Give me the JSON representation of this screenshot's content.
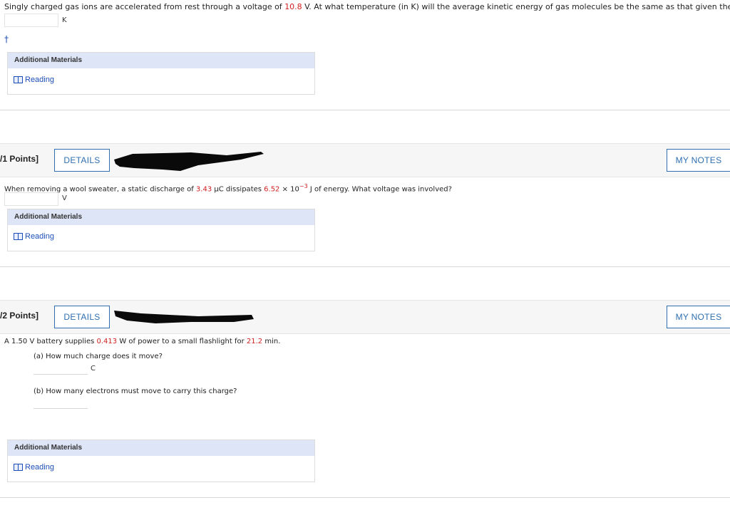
{
  "q0": {
    "text_before": "Singly charged gas ions are accelerated from rest through a voltage of ",
    "voltage": "10.8",
    "text_after": " V. At what temperature (in K) will the average kinetic energy of gas molecules be the same as that given these ions?",
    "unit": "K",
    "dagger": "†"
  },
  "additional_materials": {
    "title": "Additional Materials",
    "reading": "Reading"
  },
  "q1": {
    "points": "/1 Points]",
    "details": "DETAILS",
    "my_notes": "MY NOTES",
    "text_1": "When removing a wool sweater, a static discharge of ",
    "charge": "3.43",
    "text_2": " μC dissipates ",
    "energy": "6.52",
    "times": " × 10",
    "exp": "−3",
    "text_3": " J of energy. What voltage was involved?",
    "unit": "V"
  },
  "q2": {
    "points": "/2 Points]",
    "details": "DETAILS",
    "my_notes": "MY NOTES",
    "text_1": "A 1.50 V battery supplies ",
    "power": "0.413",
    "text_2": " W of power to a small flashlight for ",
    "time": "21.2",
    "text_3": " min.",
    "part_a": "(a) How much charge does it move?",
    "unit_a": "C",
    "part_b": "(b) How many electrons must move to carry this charge?"
  },
  "colors": {
    "accent": "#2f6fb0",
    "highlight": "#d02020",
    "panel_header": "#dde5f6",
    "link": "#1c4eb8"
  }
}
